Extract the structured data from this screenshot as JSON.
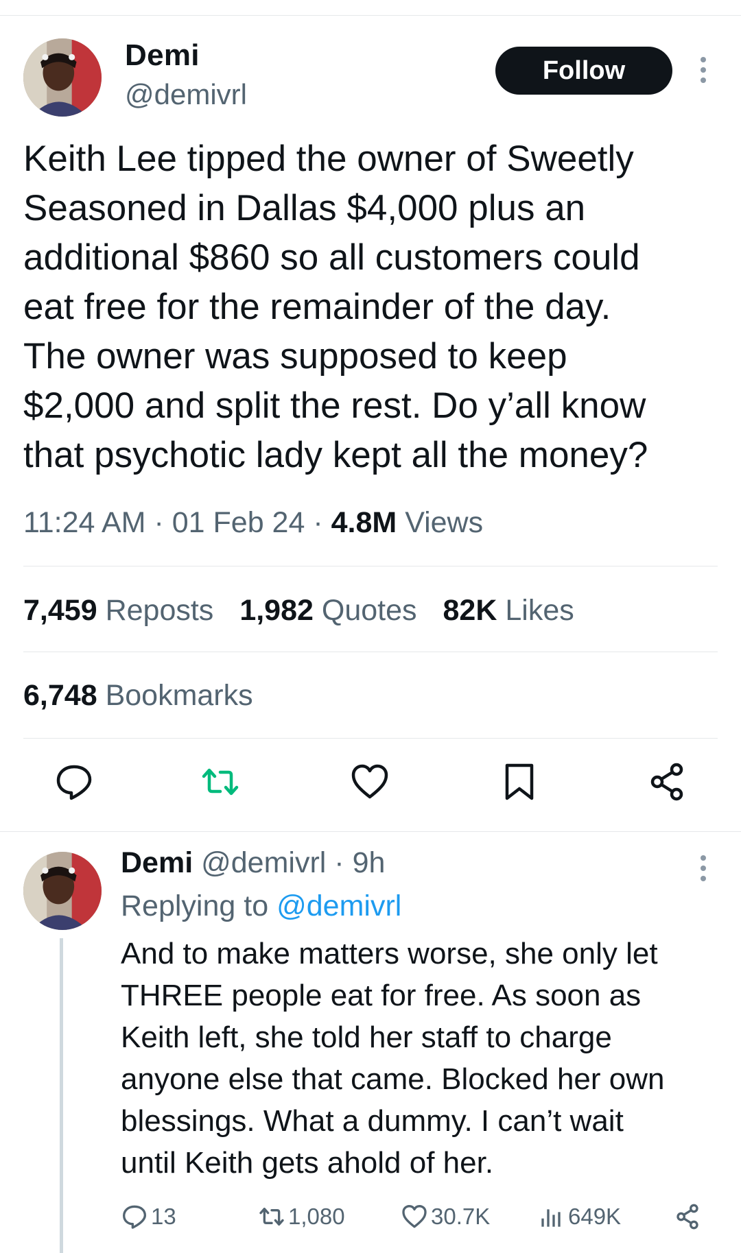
{
  "tweet": {
    "author": {
      "name": "Demi",
      "handle": "@demivrl"
    },
    "follow_label": "Follow",
    "text_lines": [
      "Keith Lee tipped the owner of Sweetly",
      "Seasoned in Dallas $4,000 plus an",
      "additional $860 so all customers could",
      "eat free for the remainder of the day.",
      "The owner was supposed to keep",
      "$2,000 and split the rest. Do y’all know",
      "that psychotic lady kept all the money?"
    ],
    "time": "11:24 AM",
    "date": "01 Feb 24",
    "separator": "·",
    "views_count": "4.8M",
    "views_label": "Views",
    "stats": [
      {
        "count": "7,459",
        "label": "Reposts"
      },
      {
        "count": "1,982",
        "label": "Quotes"
      },
      {
        "count": "82K",
        "label": "Likes"
      }
    ],
    "bookmarks": {
      "count": "6,748",
      "label": "Bookmarks"
    },
    "actions": [
      "reply-icon",
      "repost-icon",
      "like-icon",
      "bookmark-icon",
      "share-icon"
    ],
    "repost_color": "#00ba7c"
  },
  "reply": {
    "name": "Demi",
    "handle": "@demivrl",
    "age": "· 9h",
    "replying_prefix": "Replying to",
    "replying_handle": "@demivrl",
    "text_lines": [
      "And to make matters worse, she only let",
      "THREE people eat for free. As soon as",
      "Keith left, she told her staff to charge",
      "anyone else that came. Blocked her own",
      "blessings. What a dummy. I can’t wait",
      "until Keith gets ahold of her."
    ],
    "counts": {
      "replies": "13",
      "reposts": "1,080",
      "likes": "30.7K",
      "views": "649K"
    }
  },
  "colors": {
    "text": "#0f1419",
    "muted": "#536471",
    "link": "#1d9bf0",
    "divider": "#e6e8ea"
  }
}
